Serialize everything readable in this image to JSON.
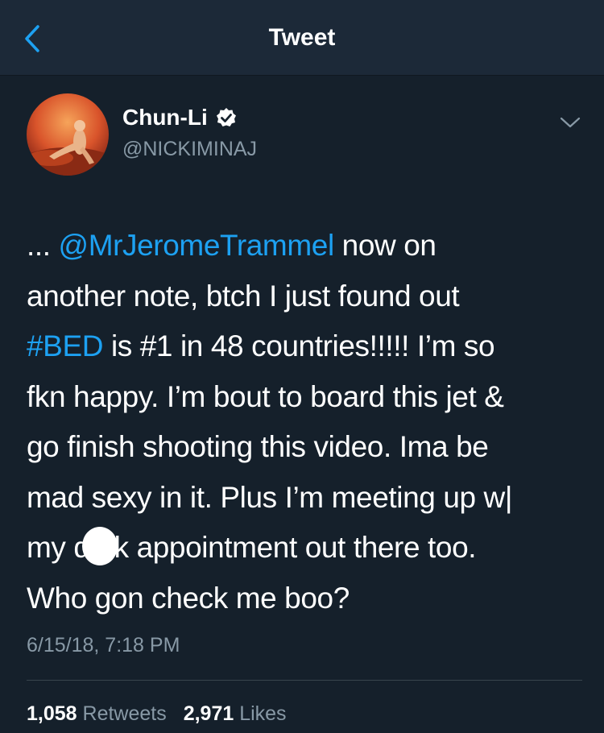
{
  "header": {
    "title": "Tweet"
  },
  "author": {
    "name": "Chun-Li",
    "handle": "@NICKIMINAJ"
  },
  "tweet": {
    "lines": [
      {
        "prefix": "... ",
        "mention": "@MrJeromeTrammel",
        "rest": " now on"
      },
      {
        "text": "another note, btch I just found out"
      },
      {
        "hashtag": "#BED",
        "rest": " is #1 in 48 countries!!!!! I’m so"
      },
      {
        "text": "fkn happy. I’m bout to board this jet &"
      },
      {
        "text": "go finish shooting this video. Ima be"
      },
      {
        "text": "mad sexy in it. Plus I’m meeting up w|"
      },
      {
        "pre": "my d",
        "post": "k appointment out there too."
      },
      {
        "text": "Who gon check me boo?"
      }
    ],
    "timestamp": "6/15/18, 7:18 PM"
  },
  "stats": {
    "retweets_count": "1,058",
    "retweets_label": " Retweets",
    "likes_count": "2,971",
    "likes_label": " Likes"
  },
  "colors": {
    "background": "#15202b",
    "navbar": "#1c2938",
    "link": "#1da1f2",
    "secondary_text": "#8899a6"
  },
  "icons": [
    "back-chevron-icon",
    "verified-badge-icon",
    "chevron-down-icon"
  ]
}
